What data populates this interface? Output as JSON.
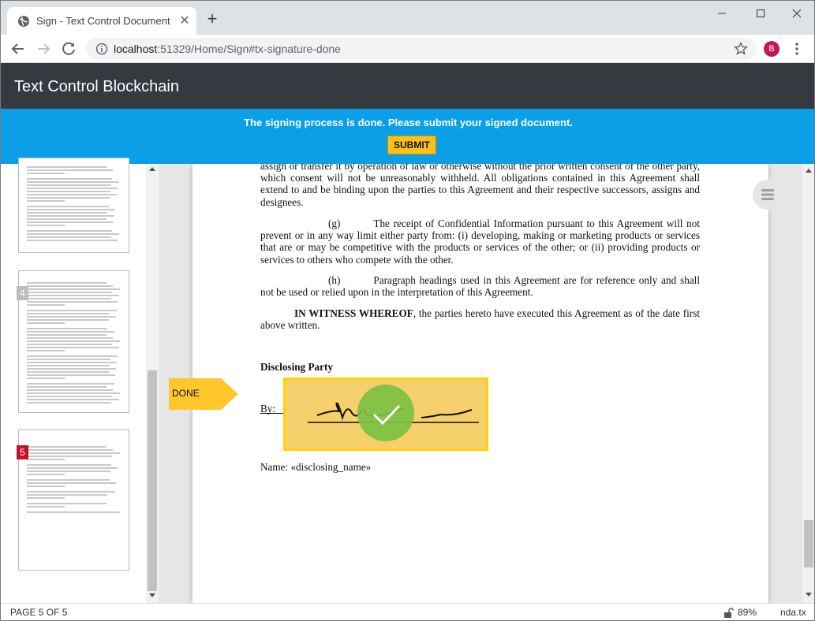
{
  "browser": {
    "tab_title": "Sign - Text Control Document Va",
    "url_host": "localhost",
    "url_rest": ":51329/Home/Sign#tx-signature-done",
    "profile_initial": "B"
  },
  "app": {
    "title": "Text Control Blockchain"
  },
  "banner": {
    "message": "The signing process is done. Please submit your signed document.",
    "submit_label": "SUBMIT"
  },
  "thumbnails": {
    "pages": [
      {
        "number": "4",
        "badge_color": "#bdbdbd"
      },
      {
        "number": "5",
        "badge_color": "#c8102e"
      }
    ]
  },
  "document": {
    "para_top": "assign or transfer it by operation of law or otherwise without the prior written consent of the other party, which consent will not be unreasonably withheld.  All obligations contained in this Agreement shall extend to and be binding upon the parties to this Agreement and their respective successors, assigns and designees.",
    "para_g_label": "(g)",
    "para_g": "The receipt of Confidential Information pursuant to this Agreement will not prevent or in any way limit either party from: (i) developing, making or marketing products or services that are or may be competitive with the products or services of the other; or (ii) providing products or services to others who compete with the other.",
    "para_h_label": "(h)",
    "para_h": "Paragraph headings used in this Agreement are for reference only and shall not be used or relied upon in the interpretation of this Agreement.",
    "witness_bold": "IN WITNESS WHEREOF",
    "witness_rest": ", the parties hereto have executed this Agreement as of the date first above written.",
    "party_heading": "Disclosing Party",
    "by_label": "By:",
    "name_line": "Name: «disclosing_name»"
  },
  "signature": {
    "done_label": "DONE",
    "box_fill": "#f6d06c",
    "box_border": "#ffd200",
    "check_color": "#7cc043"
  },
  "status": {
    "page": "PAGE 5 OF 5",
    "zoom": "89%",
    "file": "nda.tx"
  }
}
